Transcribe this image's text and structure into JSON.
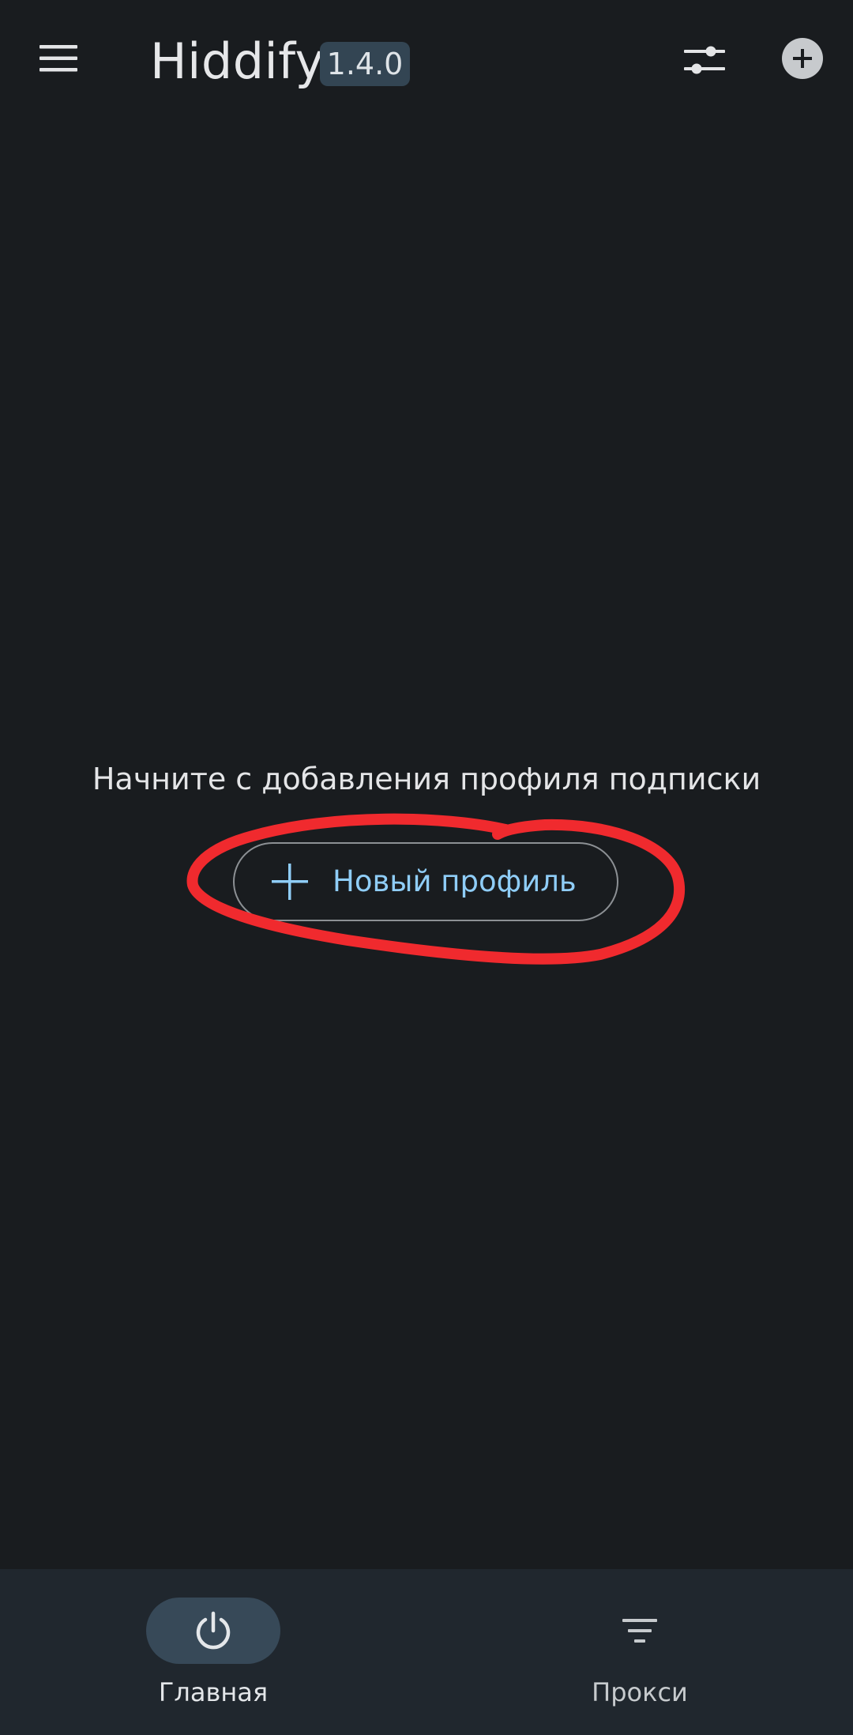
{
  "app_bar": {
    "title": "Hiddify",
    "version": "1.4.0",
    "icons": {
      "menu": "menu-icon",
      "filter": "sliders-icon",
      "add": "add-circle-icon"
    }
  },
  "empty_state": {
    "message": "Начните с добавления профиля подписки",
    "new_profile_button": {
      "label": "Новый профиль",
      "icon": "plus-icon"
    }
  },
  "bottom_nav": {
    "items": [
      {
        "label": "Главная",
        "icon": "power-icon",
        "selected": true
      },
      {
        "label": "Прокси",
        "icon": "filter-list-icon",
        "selected": false
      }
    ]
  },
  "colors": {
    "background": "#191c1f",
    "nav_background": "#20272e",
    "accent_text": "#8fcdf7",
    "selected_pill": "#374958",
    "badge_bg": "#334553",
    "annotation": "#f02a2e"
  }
}
